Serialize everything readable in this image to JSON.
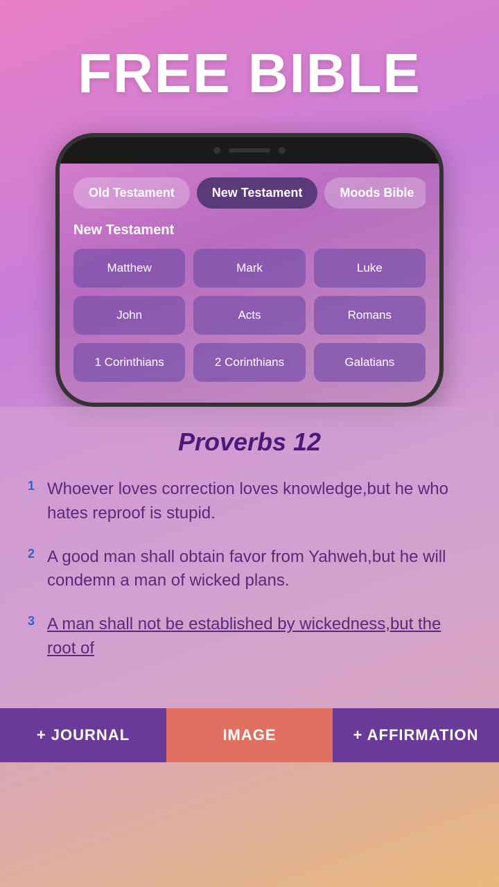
{
  "header": {
    "title": "FREE BIBLE"
  },
  "phone": {
    "tabs": [
      {
        "id": "old-testament",
        "label": "Old Testament",
        "active": false
      },
      {
        "id": "new-testament",
        "label": "New Testament",
        "active": true
      },
      {
        "id": "moods-bible",
        "label": "Moods Bible",
        "active": false
      }
    ],
    "section_label": "New Testament",
    "books": [
      {
        "id": "matthew",
        "label": "Matthew"
      },
      {
        "id": "mark",
        "label": "Mark"
      },
      {
        "id": "luke",
        "label": "Luke"
      },
      {
        "id": "john",
        "label": "John"
      },
      {
        "id": "acts",
        "label": "Acts"
      },
      {
        "id": "romans",
        "label": "Romans"
      },
      {
        "id": "1-corinthians",
        "label": "1 Corinthians"
      },
      {
        "id": "2-corinthians",
        "label": "2 Corinthians"
      },
      {
        "id": "galatians",
        "label": "Galatians"
      }
    ]
  },
  "verse_panel": {
    "chapter_title": "Proverbs 12",
    "verses": [
      {
        "num": "1",
        "text": "Whoever loves correction loves knowledge,but he who hates reproof is stupid.",
        "underlined": false
      },
      {
        "num": "2",
        "text": "A good man shall obtain favor from Yahweh,but he will condemn a man of wicked plans.",
        "underlined": false
      },
      {
        "num": "3",
        "text": "A man shall not be established by wickedness,but the root of",
        "underlined": true
      }
    ]
  },
  "bottom_bar": {
    "journal_label": "+ JOURNAL",
    "image_label": "IMAGE",
    "affirmation_label": "+ AFFIRMATION"
  }
}
